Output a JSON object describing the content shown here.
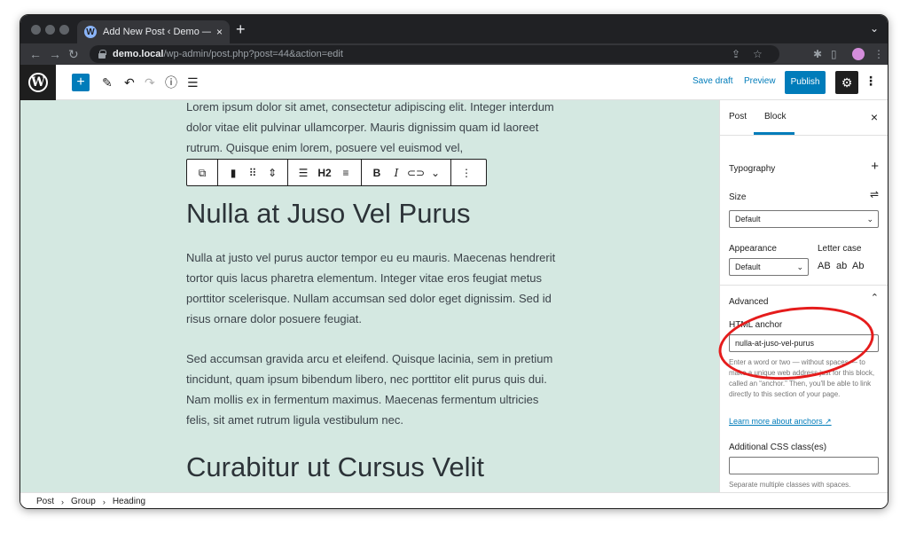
{
  "browser": {
    "tab_title": "Add New Post ‹ Demo — WordPress",
    "tab_close": "×",
    "new_tab": "+",
    "url_host": "demo.local",
    "url_path": "/wp-admin/post.php?post=44&action=edit"
  },
  "editor_header": {
    "add_block": "+",
    "save_draft": "Save draft",
    "preview": "Preview",
    "publish": "Publish"
  },
  "content": {
    "para1": "Lorem ipsum dolor sit amet, consectetur adipiscing elit. Integer interdum dolor vitae elit pulvinar ullamcorper. Mauris dignissim quam id laoreet rutrum. Quisque enim lorem, posuere vel euismod vel,",
    "heading1": "Nulla at Juso Vel Purus",
    "para2": "Nulla at justo vel purus auctor tempor eu eu mauris. Maecenas hendrerit tortor quis lacus pharetra elementum. Integer vitae eros feugiat metus porttitor scelerisque. Nullam accumsan sed dolor eget dignissim. Sed id risus ornare dolor posuere feugiat.",
    "para3": "Sed accumsan gravida arcu et eleifend. Quisque lacinia, sem in pretium tincidunt, quam ipsum bibendum libero, nec porttitor elit purus quis dui. Nam mollis ex in fermentum maximus. Maecenas fermentum ultricies felis, sit amet rutrum ligula vestibulum nec.",
    "heading2": "Curabitur ut Cursus Velit"
  },
  "block_toolbar": {
    "heading_level": "H2",
    "bold": "B",
    "italic": "I"
  },
  "sidebar": {
    "tabs": [
      "Post",
      "Block"
    ],
    "active_tab": "Block",
    "close": "×",
    "typography": "Typography",
    "size_label": "Size",
    "size_value": "Default",
    "appearance_label": "Appearance",
    "appearance_value": "Default",
    "letter_case_label": "Letter case",
    "letter_case_options": [
      "AB",
      "ab",
      "Ab"
    ],
    "advanced": "Advanced",
    "html_anchor_label": "HTML anchor",
    "html_anchor_value": "nulla-at-juso-vel-purus",
    "anchor_help": "Enter a word or two — without spaces — to make a unique web address just for this block, called an “anchor.” Then, you'll be able to link directly to this section of your page.",
    "learn_more": "Learn more about anchors",
    "css_label": "Additional CSS class(es)",
    "css_value": "",
    "css_help": "Separate multiple classes with spaces."
  },
  "breadcrumb": [
    "Post",
    "Group",
    "Heading"
  ],
  "colors": {
    "accent": "#007cba",
    "canvas": "#d4e8e1",
    "annotation": "#e51c1c"
  }
}
